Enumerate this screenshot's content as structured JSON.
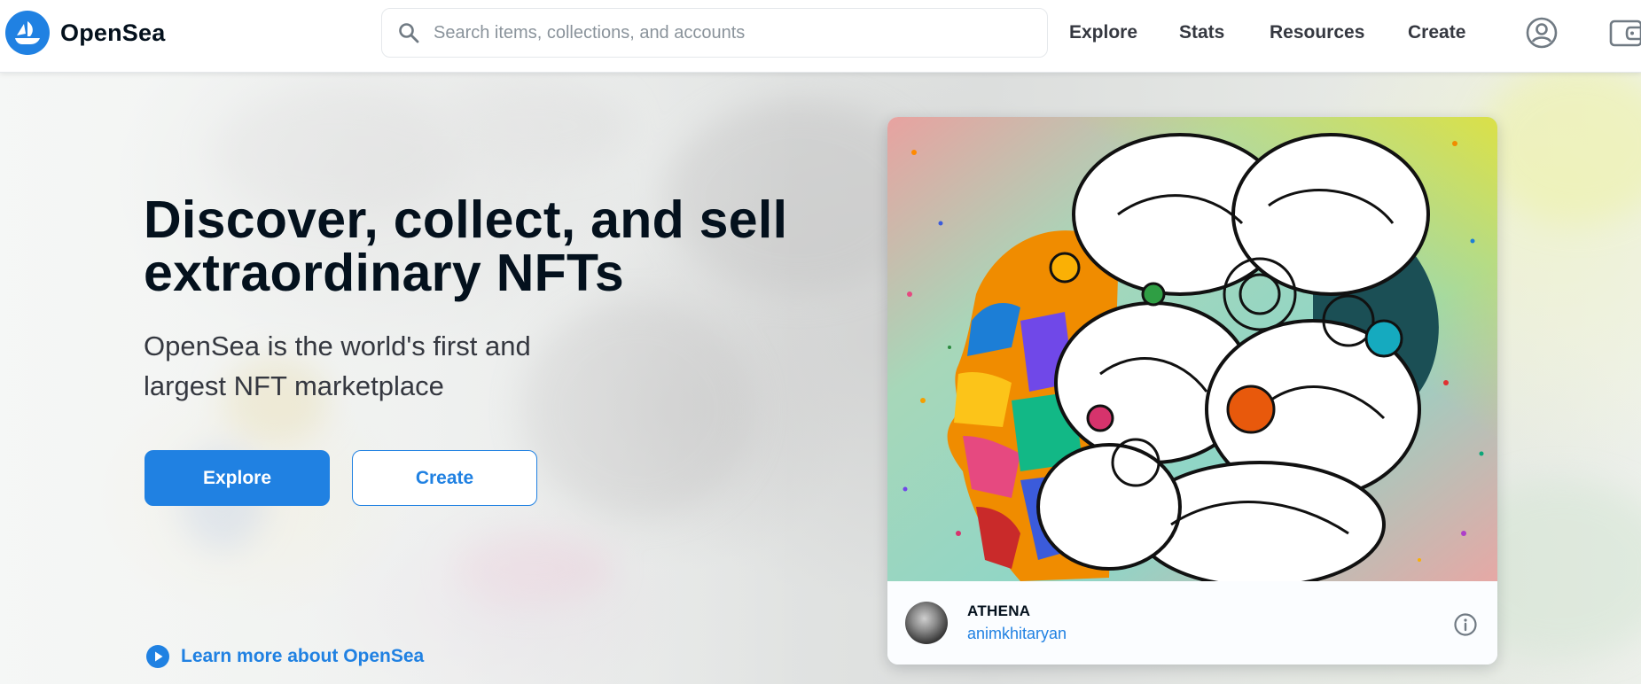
{
  "app": {
    "brand_name": "OpenSea",
    "accent_color": "#2081e2",
    "text_color": "#04111d"
  },
  "header": {
    "logo_icon": "opensea-ship-icon",
    "search": {
      "placeholder": "Search items, collections, and accounts",
      "value": "",
      "icon": "search-icon"
    },
    "nav": {
      "explore": "Explore",
      "stats": "Stats",
      "resources": "Resources",
      "create": "Create"
    },
    "account_icon": "account-circle-icon",
    "wallet_icon": "wallet-icon"
  },
  "hero": {
    "title": "Discover, collect, and sell extraordinary NFTs",
    "subtitle": "OpenSea is the world's first and largest NFT marketplace",
    "explore_label": "Explore",
    "create_label": "Create",
    "learn_more_label": "Learn more about OpenSea",
    "learn_more_icon": "play-circle-icon"
  },
  "featured": {
    "name": "ATHENA",
    "creator": "animkhitaryan",
    "info_icon": "info-icon"
  }
}
